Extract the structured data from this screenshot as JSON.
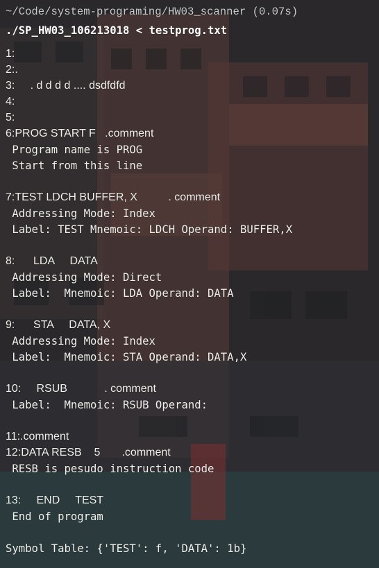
{
  "prompt": {
    "cwd": "~/Code/system-programing/HW03_scanner (0.07s)",
    "command": "./SP_HW03_106213018 < testprog.txt"
  },
  "output": [
    "1:",
    "2:.",
    "3:     . d d d d .... dsdfdfd",
    "4:",
    "5:",
    "6:PROG START F   .comment",
    " Program name is PROG",
    " Start from this line",
    "",
    "7:TEST LDCH BUFFER, X          . comment",
    " Addressing Mode: Index",
    " Label: TEST Mnemoic: LDCH Operand: BUFFER,X",
    "",
    "8:      LDA     DATA",
    " Addressing Mode: Direct",
    " Label:  Mnemoic: LDA Operand: DATA",
    "",
    "9:      STA     DATA, X",
    " Addressing Mode: Index",
    " Label:  Mnemoic: STA Operand: DATA,X",
    "",
    "10:     RSUB            . comment",
    " Label:  Mnemoic: RSUB Operand:",
    "",
    "11:.comment",
    "12:DATA RESB    5       .comment",
    " RESB is pesudo instruction code",
    "",
    "13:     END     TEST",
    " End of program",
    "",
    "Symbol Table: {'TEST': f, 'DATA': 1b}"
  ]
}
